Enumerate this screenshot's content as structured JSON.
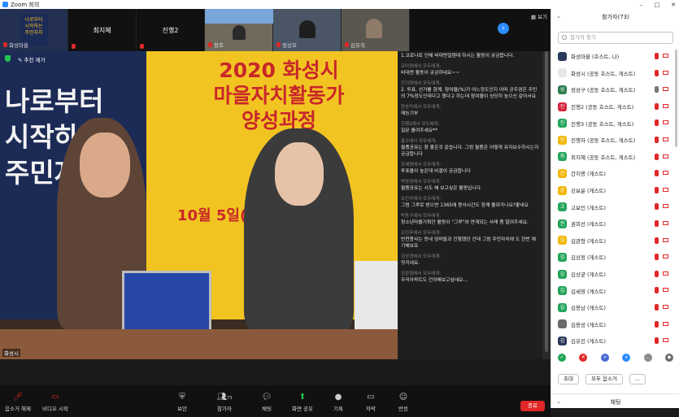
{
  "window": {
    "title": "Zoom 회의",
    "controls": [
      "–",
      "□",
      "✕"
    ]
  },
  "strip": {
    "thumbnails": [
      {
        "label": "",
        "name": "화성마을"
      },
      {
        "label": "최지혜",
        "name": ""
      },
      {
        "label": "진행2",
        "name": ""
      },
      {
        "label": "",
        "name": "창조"
      },
      {
        "label": "",
        "name": "정상호"
      },
      {
        "label": "",
        "name": "김유직"
      }
    ],
    "next": "›",
    "view_label": "보기"
  },
  "video": {
    "pin_label": "추천 제거",
    "speaker_name": "화성시",
    "poster_title": "2020 화성시\n마을자치활동가\n양성과정",
    "poster_date": "10월 5일(월)",
    "navy_text": "나로부터\n시작하는\n주민자치"
  },
  "chat": [
    {
      "from": "",
      "txt": "1.코로나로 인해 비대면일텐데 하시는 활동이 궁금합니다."
    },
    {
      "from": "유미영에서 모두에게:",
      "txt": "비대면 활동이 궁금하네요~~"
    },
    {
      "from": "간지명에서 모두에게:",
      "txt": "2. 투표, 선거를 함께, 참여율(%)가 어느정도인지 어떠 공주권은 주민의 7%정도인데다고 했다고 하는데 참여율이 상당히 높으신 같아서요"
    },
    {
      "from": "한송미에서 모두에게:",
      "txt": "재능기부"
    },
    {
      "from": "진행2에서 모두에게:",
      "txt": "질문 올려주세요**"
    },
    {
      "from": "홍수에서 모두에게:",
      "txt": "월품공유는 참 좋은것 같습니다. 그럼 월품은 어떻게 유지보수하시는지 궁금합니다"
    },
    {
      "from": "조혜원에서 모두에게:",
      "txt": "투표율이 높은데 비결이 궁금합니다"
    },
    {
      "from": "박영경에서 모두에게:",
      "txt": "월품공유는 시도 해 보고싶은 활동입니다"
    },
    {
      "from": "오진주에서 모두에게:",
      "txt": "그럼 그루로 받으면 1365에 봉사시간도 함께 올려가나요?좋네요"
    },
    {
      "from": "박동구에서 모두에게:",
      "txt": "청소년마을기획단 활동이 \"그루\"와 연계되는 사례 좀 말려주세요."
    },
    {
      "from": "오진주에서 모두에게:",
      "txt": "반찬봉사는 동네 엄마들과 진행했던 건데 그럼 주민자치에 도 한번 얘기해보죠"
    },
    {
      "from": "김성경에서 모두에게:",
      "txt": "멋지네요."
    },
    {
      "from": "김관형에서 모두에게:",
      "txt": "우리아파트도 건의해보고싶네요..."
    }
  ],
  "toolbar": {
    "audio": "음소거 해제",
    "video": "비디오 시작",
    "security": "보안",
    "participants": "참가자",
    "participants_count": "73",
    "chat": "채팅",
    "share": "화면 공유",
    "record": "기록",
    "cc": "자막",
    "reactions": "반응",
    "end": "종료"
  },
  "panel": {
    "title": "참가자(73)",
    "search_placeholder": "참가자 찾기",
    "participants": [
      {
        "name": "화성마을 (호스트, 나)",
        "initial": "",
        "color": "#2b3a5c",
        "mic": "off",
        "cam": "off"
      },
      {
        "name": "화성시 (공동 호스트, 게스트)",
        "initial": "",
        "color": "#e8e8e8",
        "mic": "off",
        "cam": "off"
      },
      {
        "name": "정성구 (공동 호스트, 게스트)",
        "initial": "성구",
        "color": "#2e7d4f",
        "mic": "on",
        "cam": "off"
      },
      {
        "name": "진행2 (공동 호스트, 게스트)",
        "initial": "진",
        "color": "#d7263d",
        "mic": "off",
        "cam": "off"
      },
      {
        "name": "진행3 (공동 호스트, 게스트)",
        "initial": "진",
        "color": "#23a55a",
        "mic": "off",
        "cam": "off"
      },
      {
        "name": "진행자 (공동 호스트, 게스트)",
        "initial": "진",
        "color": "#f2b705",
        "mic": "off",
        "cam": "off"
      },
      {
        "name": "최지혜 (공동 호스트, 게스트)",
        "initial": "최",
        "color": "#23a55a",
        "mic": "off",
        "cam": "off"
      },
      {
        "name": "간지명 (게스트)",
        "initial": "간",
        "color": "#f2b705",
        "mic": "off",
        "cam": "off"
      },
      {
        "name": "강보윤 (게스트)",
        "initial": "강",
        "color": "#f2b705",
        "mic": "off",
        "cam": "off"
      },
      {
        "name": "고보민 (게스트)",
        "initial": "고",
        "color": "#23a55a",
        "mic": "off",
        "cam": "off"
      },
      {
        "name": "권희선 (게스트)",
        "initial": "권",
        "color": "#23a55a",
        "mic": "off",
        "cam": "off"
      },
      {
        "name": "김관형 (게스트)",
        "initial": "김",
        "color": "#f2b705",
        "mic": "off",
        "cam": "off"
      },
      {
        "name": "김상정 (게스트)",
        "initial": "김",
        "color": "#23a55a",
        "mic": "off",
        "cam": "off"
      },
      {
        "name": "김상균 (게스트)",
        "initial": "김",
        "color": "#23a55a",
        "mic": "off",
        "cam": "off"
      },
      {
        "name": "김세영 (게스트)",
        "initial": "김",
        "color": "#23a55a",
        "mic": "off",
        "cam": "off"
      },
      {
        "name": "김용남 (게스트)",
        "initial": "김",
        "color": "#23a55a",
        "mic": "off",
        "cam": "off"
      },
      {
        "name": "김용성 (게스트)",
        "initial": "",
        "color": "#6b6b6b",
        "mic": "off",
        "cam": "off"
      },
      {
        "name": "김유진 (게스트)",
        "initial": "김",
        "color": "#2b3a5c",
        "mic": "off",
        "cam": "off"
      }
    ],
    "feedback": [
      {
        "sym": "✓",
        "color": "#23a55a"
      },
      {
        "sym": "✕",
        "color": "#e02828"
      },
      {
        "sym": "«",
        "color": "#4a6cd4"
      },
      {
        "sym": "»",
        "color": "#2d8cff"
      },
      {
        "sym": "…",
        "color": "#8a8a8a"
      },
      {
        "sym": "◆",
        "color": "#6b6b6b"
      }
    ],
    "invite": "초대",
    "mute_all": "모두 음소거",
    "more": "...",
    "chat_title": "채팅"
  }
}
